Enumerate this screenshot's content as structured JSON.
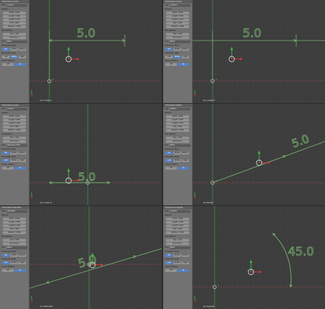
{
  "viewports": [
    {
      "id": "v1",
      "panel_header": "Dimensions Linear",
      "type_label": "Type",
      "type_value": "Linear-1",
      "options_label": "Options",
      "fields": [
        "Width: 0.060",
        "Length: 5.000",
        "Length: 0.100",
        "Dist: 0.000",
        "Rotation: 0.000"
      ],
      "text_options_label": "Text Options",
      "text_fields": [
        "Size: 1.000",
        "Rounding: 1"
      ],
      "font_label": "Font",
      "font_value": "Bfont",
      "rows": [
        {
          "label": "Dimension Style",
          "items": [
            "Top",
            "Middle",
            "Bottom"
          ],
          "active": 0
        },
        {
          "label": "Dimension Align",
          "items": [
            "Left",
            "Middle",
            "Right"
          ],
          "active": 1
        }
      ],
      "cursor_label": "Cursor Position",
      "cursor_items": [
        "Off",
        "On"
      ],
      "object_label": "(1) Linear-1",
      "dim_text": "5.0"
    },
    {
      "id": "v2",
      "panel_header": "Dimensions Linear",
      "type_label": "Type",
      "type_value": "Linear-2",
      "options_label": "Options",
      "fields": [
        "Width: 0.060",
        "Length: 5.000",
        "Length: 0.100",
        "Dist: 0.000",
        "Rotation: 0.000"
      ],
      "text_options_label": "Text Options",
      "text_fields": [
        "Size: 1.000",
        "Rounding: 1"
      ],
      "font_label": "Font",
      "font_value": "Bfont",
      "rows": [
        {
          "label": "Dimension Style",
          "items": [
            "Top",
            "Middle",
            "Bottom"
          ],
          "active": 0
        },
        {
          "label": "Dimension Align",
          "items": [
            "Left",
            "Middle",
            "Right"
          ],
          "active": 1
        }
      ],
      "cursor_label": "Cursor Position",
      "cursor_items": [
        "Off",
        "On"
      ],
      "object_label": "(1) Linear-2",
      "dim_text": "5.0"
    },
    {
      "id": "v3",
      "panel_header": "Dimensions Linear",
      "type_label": "Type",
      "type_value": "Linear-3",
      "options_label": "Options",
      "fields": [
        "Width: 0.060",
        "Length: 5.000",
        "Length: 0.100",
        "Dist: 0.000",
        "Rotation: 0.000"
      ],
      "text_options_label": "Text Options",
      "text_fields": [
        "Size: 1.000",
        "Rounding: 1"
      ],
      "font_label": "Font",
      "font_value": "Dimension Font",
      "rows": [
        {
          "label": "Dimension Style",
          "items": [
            "Top",
            "Middle",
            "Bottom"
          ],
          "active": 0
        },
        {
          "label": "Dimension Align",
          "items": [
            "Left",
            "Middle",
            "Right"
          ],
          "active": 0
        }
      ],
      "cursor_label": "Cursor Position",
      "cursor_items": [
        "Off",
        "On"
      ],
      "object_label": "(1) Linear-3",
      "dim_text": "5.0"
    },
    {
      "id": "v4",
      "panel_header": "Dimensions Radial",
      "type_label": "Type",
      "type_value": "Radial",
      "options_label": "Options",
      "fields": [
        "Width: 0.060",
        "Length: 5.000",
        "Length: 0.100",
        "Dist: 0.000",
        "Rotation: 0.000"
      ],
      "text_options_label": "Text Options",
      "text_fields": [
        "Size: 1.000",
        "Rounding: 1"
      ],
      "font_label": "Font",
      "font_value": "Bfont",
      "rows": [
        {
          "label": "Dimension Style",
          "items": [
            "Top",
            "Middle",
            "Bottom"
          ],
          "active": 0
        },
        {
          "label": "Dimension Align",
          "items": [
            "Left",
            "Middle",
            "Right"
          ],
          "active": 0
        }
      ],
      "cursor_label": "Cursor Position",
      "cursor_items": [
        "Off",
        "On"
      ],
      "object_label": "(1) Radial",
      "dim_text": "5.0"
    },
    {
      "id": "v5",
      "panel_header": "Dimensions Diameter",
      "type_label": "Type",
      "type_value": "Diameter",
      "options_label": "Options",
      "fields": [
        "Width: 0.060",
        "Length: 5.000",
        "Length: 0.100",
        "Dist: 0.000",
        "Rotation: 0.000"
      ],
      "text_options_label": "Text Options",
      "text_fields": [
        "Size: 1.000",
        "Rounding: 1"
      ],
      "font_label": "Font",
      "font_value": "Bfont",
      "rows": [
        {
          "label": "Dimension Style",
          "items": [
            "Top",
            "Middle",
            "Bottom"
          ],
          "active": 0
        },
        {
          "label": "Dimension Align",
          "items": [
            "Left",
            "Middle",
            "Right"
          ],
          "active": 0
        }
      ],
      "cursor_label": "Cursor Position",
      "cursor_items": [
        "Off",
        "On"
      ],
      "object_label": "(1) Diameter",
      "dim_text": "5.0"
    },
    {
      "id": "v6",
      "panel_header": "Dimensions Angular",
      "type_label": "Type",
      "type_value": "Angular",
      "options_label": "Options",
      "fields": [
        "Width: 0.060",
        "Length: 5.000",
        "Length: 0.100",
        "Dist: 0.000",
        "Rotation: 0.000"
      ],
      "text_options_label": "Text Options",
      "text_fields": [
        "Size: 1.000",
        "Rounding: 1"
      ],
      "font_label": "Font",
      "font_value": "Bfont",
      "rows": [
        {
          "label": "Dimension Style",
          "items": [
            "Top",
            "Middle",
            "Bottom"
          ],
          "active": 0
        },
        {
          "label": "Dimension Align",
          "items": [
            "Left",
            "Middle",
            "Right"
          ],
          "active": 0
        }
      ],
      "cursor_label": "Cursor Position",
      "cursor_items": [
        "Off",
        "On"
      ],
      "object_label": "(1) Angular",
      "dim_text": "45.0"
    }
  ],
  "colors": {
    "grid_bg": "#3d3d3d",
    "grid_line": "#444444",
    "dimension": "#78b46e",
    "y_axis": "#4a9a4a",
    "x_axis": "#b04848",
    "panel_bg": "#727272",
    "button_active": "#5680c2"
  }
}
